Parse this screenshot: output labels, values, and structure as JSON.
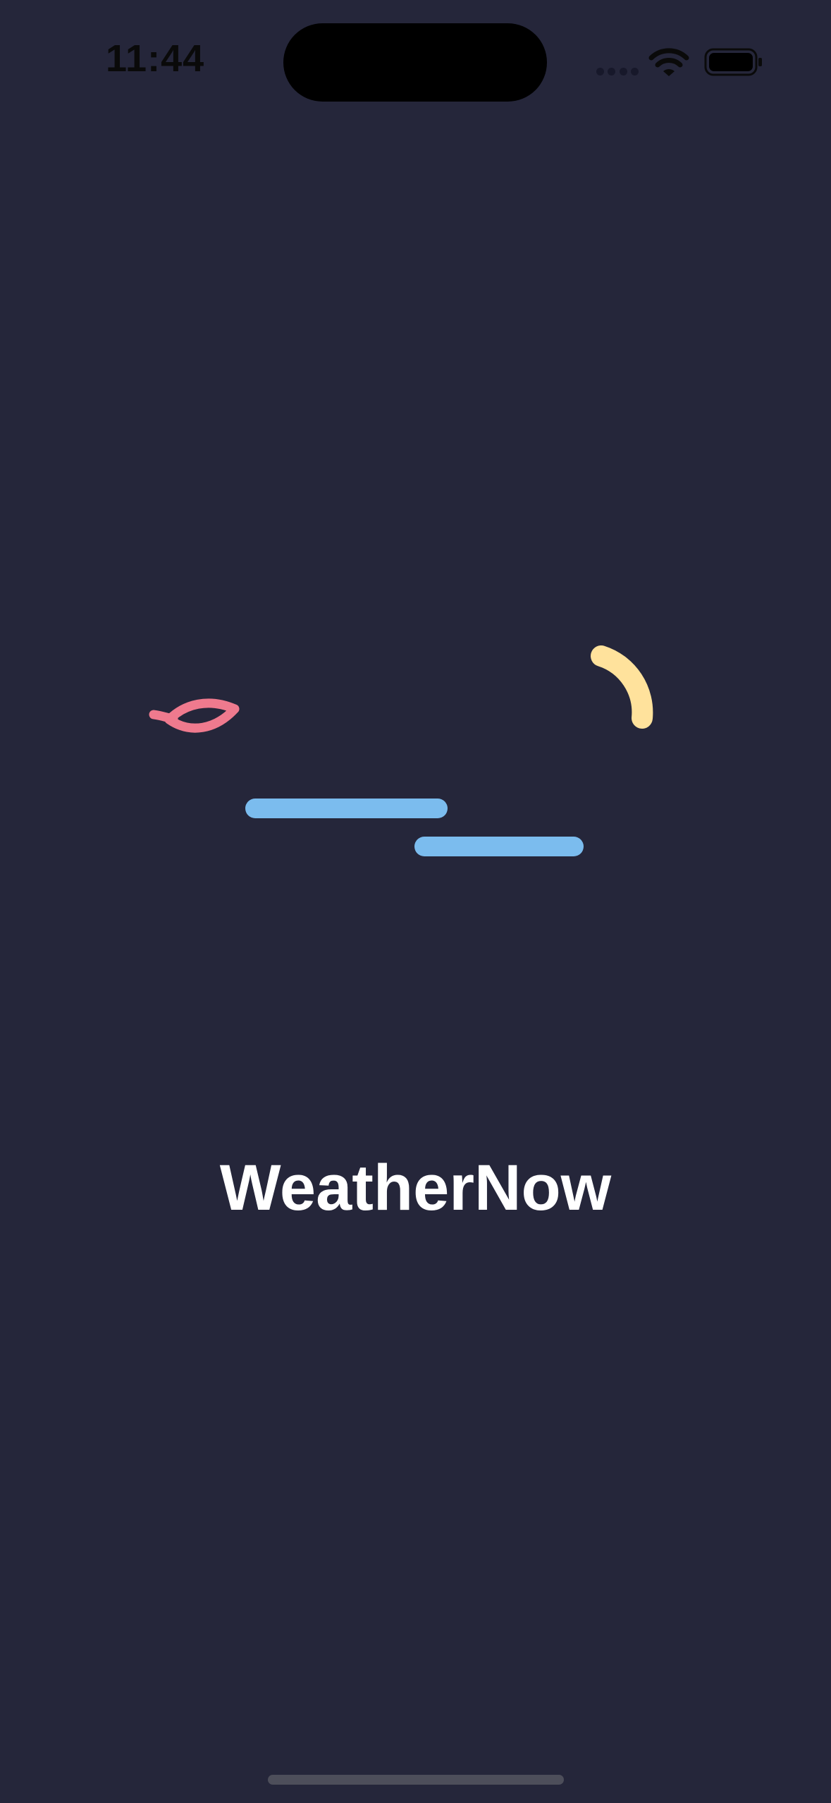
{
  "status_bar": {
    "time": "11:44",
    "icons": [
      "signal-dots-icon",
      "wifi-icon",
      "battery-icon"
    ]
  },
  "splash": {
    "app_name": "WeatherNow",
    "graphic_icons": [
      "leaf-icon",
      "wind-line-icon",
      "sun-arc-icon"
    ]
  },
  "colors": {
    "background": "#25263a",
    "title": "#ffffff",
    "leaf": "#ef7a8e",
    "wind": "#7bbcee",
    "sun": "#ffe29c",
    "home_indicator": "#4d4e5a"
  }
}
